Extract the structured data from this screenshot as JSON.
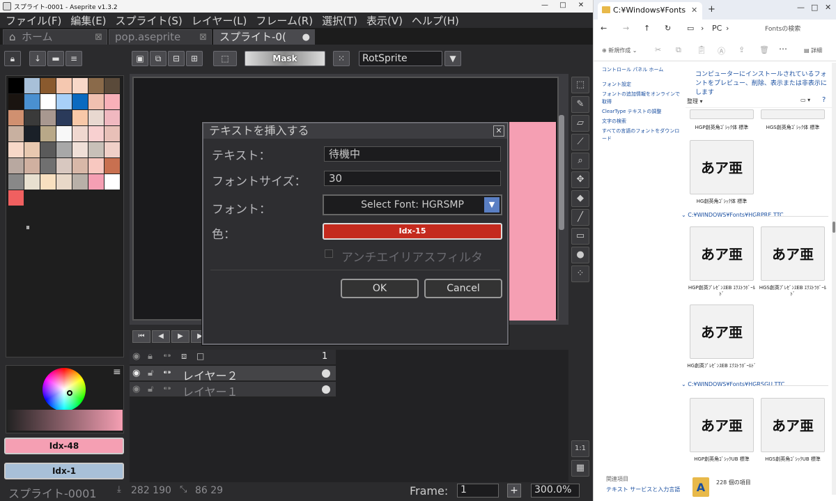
{
  "aseprite": {
    "window_title": "スプライト-0001 - Aseprite v1.3.2",
    "window_buttons": [
      "—",
      "□",
      "✕"
    ],
    "menu": [
      "ファイル(F)",
      "編集(E)",
      "スプライト(S)",
      "レイヤー(L)",
      "フレーム(R)",
      "選択(T)",
      "表示(V)",
      "ヘルプ(H)"
    ],
    "tabs": [
      {
        "label": "ホーム",
        "close": "⊠"
      },
      {
        "label": "pop.aseprite",
        "close": "⊠"
      },
      {
        "label": "スプライト-0(",
        "close": "●"
      }
    ],
    "toolbar": {
      "mask_label": "Mask",
      "rotation_algorithm": "RotSprite"
    },
    "palette_colors": [
      "#000000",
      "#a8c0d8",
      "#8a5a2e",
      "#f5c8b0",
      "#f8d8c8",
      "#8a6a4a",
      "#5a4a3a",
      "#1a1410",
      "#4a90d0",
      "#ffffff",
      "#a8d0f8",
      "#0a6ac0",
      "#f0c0b0",
      "#f8b0b8",
      "#d09070",
      "#3a3a3a",
      "#a89890",
      "#2a3a5a",
      "#f8c8a8",
      "#e8d8d0",
      "#f0b8c0",
      "#c8b0a0",
      "#1a2028",
      "#b8a888",
      "#f8f8f8",
      "#f0d8d0",
      "#f8d0d0",
      "#e8c0b8",
      "#f8d8c8",
      "#e8c8b0",
      "#5a5a5a",
      "#a8a8a8",
      "#f0e0d8",
      "#c8c0b8",
      "#f0d0c8",
      "#b8a8a0",
      "#d0b0a0",
      "#707070",
      "#d8c8c0",
      "#d8b8a8",
      "#f8c8c0",
      "#c87050",
      "#888888",
      "#e8e0d0",
      "#f8e0c0",
      "#e8d8c8",
      "#b8b0a8",
      "#f59fb3",
      "#ffffff",
      "#f06060"
    ],
    "layers": [
      {
        "name": "レイヤー２",
        "active": true
      },
      {
        "name": "レイヤー１",
        "active": false
      }
    ],
    "frame_header": "1",
    "foreground_color": {
      "label": "Idx-48",
      "hex": "#f59fb3"
    },
    "background_color": {
      "label": "Idx-1",
      "hex": "#a8c0d8"
    },
    "status": {
      "sprite_name": "スプライト-0001",
      "position": "282 190",
      "size": "86 29",
      "frame_label": "Frame:",
      "frame_value": "1",
      "zoom": "300.0%"
    },
    "right_buttons": {
      "ratio": "1:1"
    },
    "dialog": {
      "title": "テキストを挿入する",
      "text_label": "テキスト：",
      "text_value": "待機中",
      "size_label": "フォントサイズ：",
      "size_value": "30",
      "font_label": "フォント：",
      "font_value": "Select Font: HGRSMP",
      "color_label": "色：",
      "color_value": "Idx-15",
      "color_hex": "#c42a1e",
      "antialias_label": "アンチエイリアスフィルタ",
      "ok": "OK",
      "cancel": "Cancel"
    }
  },
  "explorer": {
    "tab_title": "C:¥Windows¥Fonts",
    "breadcrumb": [
      "PC",
      "›"
    ],
    "search_placeholder": "Fontsの検索",
    "cmd_new": "新規作成",
    "cmd_details": "詳細",
    "left_links": [
      "コントロール パネル ホーム",
      "フォント設定",
      "フォントの追加情報をオンラインで取得",
      "ClearType テキストの調整",
      "文字の検索",
      "すべての言語のフォントをダウンロード"
    ],
    "heading": "コンピューターにインストールされているフォントをプレビュー、削除、表示または非表示にします",
    "organize": "整理",
    "fonts_top": [
      "HGP創英角ｺﾞｼｯｸ体 標準",
      "HGS創英角ｺﾞｼｯｸ体 標準"
    ],
    "group1_extra": "HG創英角ｺﾞｼｯｸ体 標準",
    "groups": [
      {
        "path": "C:¥WINDOWS¥Fonts¥HGRPRE.TTC",
        "fonts": [
          "HGP創英ﾌﾟﾚｾﾞﾝｽEB ｴｸｽﾄﾗﾎﾞｰﾙﾄﾞ",
          "HGS創英ﾌﾟﾚｾﾞﾝｽEB ｴｸｽﾄﾗﾎﾞｰﾙﾄﾞ",
          "HG創英ﾌﾟﾚｾﾞﾝｽEB ｴｸｽﾄﾗﾎﾞｰﾙﾄﾞ"
        ]
      },
      {
        "path": "C:¥WINDOWS¥Fonts¥HGRSGU.TTC",
        "fonts": [
          "HGP創英角ｺﾞｼｯｸUB 標準",
          "HGS創英角ｺﾞｼｯｸUB 標準"
        ]
      }
    ],
    "sample_glyph": "あア亜",
    "related_title": "関連項目",
    "related_link": "テキスト サービスと入力言語",
    "item_count": "228 個の項目"
  }
}
